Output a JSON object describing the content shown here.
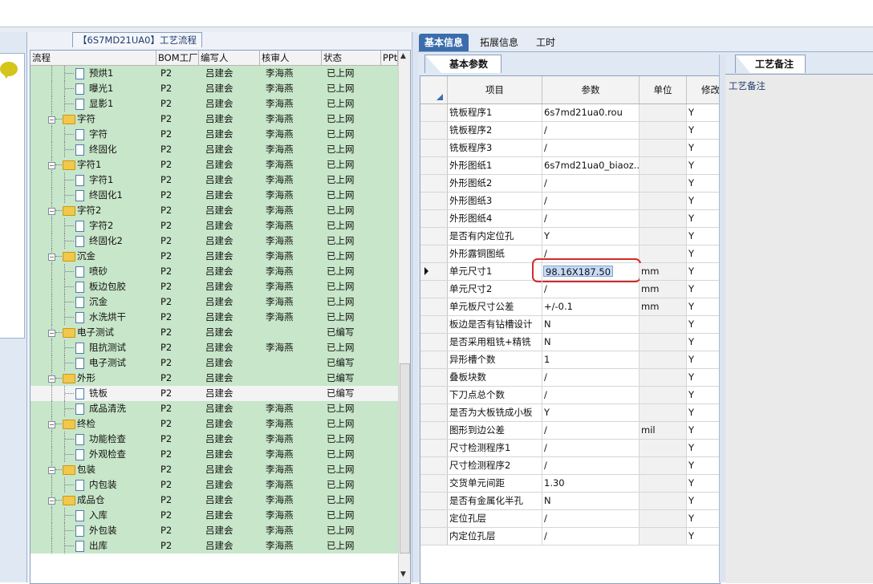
{
  "process_panel": {
    "title": "【6S7MD21UA0】工艺流程",
    "columns": [
      "流程",
      "BOM工厂",
      "编写人",
      "核审人",
      "状态",
      "PPt"
    ],
    "rows": [
      {
        "name": "预烘1",
        "level": 2,
        "type": "doc",
        "bom": "P2",
        "author": "吕建会",
        "reviewer": "李海燕",
        "status": "已上网"
      },
      {
        "name": "曝光1",
        "level": 2,
        "type": "doc",
        "bom": "P2",
        "author": "吕建会",
        "reviewer": "李海燕",
        "status": "已上网"
      },
      {
        "name": "显影1",
        "level": 2,
        "type": "doc",
        "bom": "P2",
        "author": "吕建会",
        "reviewer": "李海燕",
        "status": "已上网"
      },
      {
        "name": "字符",
        "level": 1,
        "type": "folder",
        "bom": "P2",
        "author": "吕建会",
        "reviewer": "李海燕",
        "status": "已上网"
      },
      {
        "name": "字符",
        "level": 2,
        "type": "doc",
        "bom": "P2",
        "author": "吕建会",
        "reviewer": "李海燕",
        "status": "已上网"
      },
      {
        "name": "终固化",
        "level": 2,
        "type": "doc",
        "bom": "P2",
        "author": "吕建会",
        "reviewer": "李海燕",
        "status": "已上网"
      },
      {
        "name": "字符1",
        "level": 1,
        "type": "folder",
        "bom": "P2",
        "author": "吕建会",
        "reviewer": "李海燕",
        "status": "已上网"
      },
      {
        "name": "字符1",
        "level": 2,
        "type": "doc",
        "bom": "P2",
        "author": "吕建会",
        "reviewer": "李海燕",
        "status": "已上网"
      },
      {
        "name": "终固化1",
        "level": 2,
        "type": "doc",
        "bom": "P2",
        "author": "吕建会",
        "reviewer": "李海燕",
        "status": "已上网"
      },
      {
        "name": "字符2",
        "level": 1,
        "type": "folder",
        "bom": "P2",
        "author": "吕建会",
        "reviewer": "李海燕",
        "status": "已上网"
      },
      {
        "name": "字符2",
        "level": 2,
        "type": "doc",
        "bom": "P2",
        "author": "吕建会",
        "reviewer": "李海燕",
        "status": "已上网"
      },
      {
        "name": "终固化2",
        "level": 2,
        "type": "doc",
        "bom": "P2",
        "author": "吕建会",
        "reviewer": "李海燕",
        "status": "已上网"
      },
      {
        "name": "沉金",
        "level": 1,
        "type": "folder",
        "bom": "P2",
        "author": "吕建会",
        "reviewer": "李海燕",
        "status": "已上网"
      },
      {
        "name": "喷砂",
        "level": 2,
        "type": "doc",
        "bom": "P2",
        "author": "吕建会",
        "reviewer": "李海燕",
        "status": "已上网"
      },
      {
        "name": "板边包胶",
        "level": 2,
        "type": "doc",
        "bom": "P2",
        "author": "吕建会",
        "reviewer": "李海燕",
        "status": "已上网"
      },
      {
        "name": "沉金",
        "level": 2,
        "type": "doc",
        "bom": "P2",
        "author": "吕建会",
        "reviewer": "李海燕",
        "status": "已上网"
      },
      {
        "name": "水洗烘干",
        "level": 2,
        "type": "doc",
        "bom": "P2",
        "author": "吕建会",
        "reviewer": "李海燕",
        "status": "已上网"
      },
      {
        "name": "电子测试",
        "level": 1,
        "type": "folder",
        "bom": "P2",
        "author": "吕建会",
        "reviewer": "",
        "status": "已编写"
      },
      {
        "name": "阻抗测试",
        "level": 2,
        "type": "doc",
        "bom": "P2",
        "author": "吕建会",
        "reviewer": "李海燕",
        "status": "已上网"
      },
      {
        "name": "电子测试",
        "level": 2,
        "type": "doc",
        "bom": "P2",
        "author": "吕建会",
        "reviewer": "",
        "status": "已编写"
      },
      {
        "name": "外形",
        "level": 1,
        "type": "folder",
        "bom": "P2",
        "author": "吕建会",
        "reviewer": "",
        "status": "已编写"
      },
      {
        "name": "铣板",
        "level": 2,
        "type": "doc",
        "bom": "P2",
        "author": "吕建会",
        "reviewer": "",
        "status": "已编写",
        "selected": true
      },
      {
        "name": "成品清洗",
        "level": 2,
        "type": "doc",
        "bom": "P2",
        "author": "吕建会",
        "reviewer": "李海燕",
        "status": "已上网"
      },
      {
        "name": "终检",
        "level": 1,
        "type": "folder",
        "bom": "P2",
        "author": "吕建会",
        "reviewer": "李海燕",
        "status": "已上网"
      },
      {
        "name": "功能检查",
        "level": 2,
        "type": "doc",
        "bom": "P2",
        "author": "吕建会",
        "reviewer": "李海燕",
        "status": "已上网"
      },
      {
        "name": "外观检查",
        "level": 2,
        "type": "doc",
        "bom": "P2",
        "author": "吕建会",
        "reviewer": "李海燕",
        "status": "已上网"
      },
      {
        "name": "包装",
        "level": 1,
        "type": "folder",
        "bom": "P2",
        "author": "吕建会",
        "reviewer": "李海燕",
        "status": "已上网"
      },
      {
        "name": "内包装",
        "level": 2,
        "type": "doc",
        "bom": "P2",
        "author": "吕建会",
        "reviewer": "李海燕",
        "status": "已上网"
      },
      {
        "name": "成品仓",
        "level": 1,
        "type": "folder",
        "bom": "P2",
        "author": "吕建会",
        "reviewer": "李海燕",
        "status": "已上网"
      },
      {
        "name": "入库",
        "level": 2,
        "type": "doc",
        "bom": "P2",
        "author": "吕建会",
        "reviewer": "李海燕",
        "status": "已上网"
      },
      {
        "name": "外包装",
        "level": 2,
        "type": "doc",
        "bom": "P2",
        "author": "吕建会",
        "reviewer": "李海燕",
        "status": "已上网"
      },
      {
        "name": "出库",
        "level": 2,
        "type": "doc",
        "bom": "P2",
        "author": "吕建会",
        "reviewer": "李海燕",
        "status": "已上网"
      }
    ]
  },
  "tabs": [
    "基本信息",
    "拓展信息",
    "工时"
  ],
  "active_tab": "基本信息",
  "subtab": "基本参数",
  "params_grid": {
    "columns": [
      "项目",
      "参数",
      "单位",
      "修改"
    ],
    "rows": [
      {
        "item": "铣板程序1",
        "value": "6s7md21ua0.rou",
        "unit": "",
        "mod": "Y"
      },
      {
        "item": "铣板程序2",
        "value": "/",
        "unit": "",
        "mod": "Y"
      },
      {
        "item": "铣板程序3",
        "value": "/",
        "unit": "",
        "mod": "Y"
      },
      {
        "item": "外形图纸1",
        "value": "6s7md21ua0_biaoz...",
        "unit": "",
        "mod": "Y"
      },
      {
        "item": "外形图纸2",
        "value": "/",
        "unit": "",
        "mod": "Y"
      },
      {
        "item": "外形图纸3",
        "value": "/",
        "unit": "",
        "mod": "Y"
      },
      {
        "item": "外形图纸4",
        "value": "/",
        "unit": "",
        "mod": "Y"
      },
      {
        "item": "是否有内定位孔",
        "value": "Y",
        "unit": "",
        "mod": "Y"
      },
      {
        "item": "外形露铜图纸",
        "value": "/",
        "unit": "",
        "mod": "Y"
      },
      {
        "item": "单元尺寸1",
        "value": "98.16X187.50",
        "unit": "mm",
        "mod": "Y",
        "editing": true
      },
      {
        "item": "单元尺寸2",
        "value": "/",
        "unit": "mm",
        "mod": "Y"
      },
      {
        "item": "单元板尺寸公差",
        "value": "+/-0.1",
        "unit": "mm",
        "mod": "Y"
      },
      {
        "item": "板边是否有钻槽设计",
        "value": "N",
        "unit": "",
        "mod": "Y"
      },
      {
        "item": "是否采用粗铣+精铣",
        "value": "N",
        "unit": "",
        "mod": "Y"
      },
      {
        "item": "异形槽个数",
        "value": "1",
        "unit": "",
        "mod": "Y"
      },
      {
        "item": "叠板块数",
        "value": "/",
        "unit": "",
        "mod": "Y"
      },
      {
        "item": "下刀点总个数",
        "value": "/",
        "unit": "",
        "mod": "Y"
      },
      {
        "item": "是否为大板铣成小板",
        "value": "Y",
        "unit": "",
        "mod": "Y"
      },
      {
        "item": "图形到边公差",
        "value": "/",
        "unit": "mil",
        "mod": "Y"
      },
      {
        "item": "尺寸检测程序1",
        "value": "/",
        "unit": "",
        "mod": "Y"
      },
      {
        "item": "尺寸检测程序2",
        "value": "/",
        "unit": "",
        "mod": "Y"
      },
      {
        "item": "交货单元间距",
        "value": "1.30",
        "unit": "",
        "mod": "Y"
      },
      {
        "item": "是否有金属化半孔",
        "value": "N",
        "unit": "",
        "mod": "Y"
      },
      {
        "item": "定位孔层",
        "value": "/",
        "unit": "",
        "mod": "Y"
      },
      {
        "item": "内定位孔层",
        "value": "/",
        "unit": "",
        "mod": "Y"
      }
    ]
  },
  "remarks": {
    "tab": "工艺备注",
    "label": "工艺备注"
  },
  "colors": {
    "row_green": "#c8e6c9",
    "tab_active": "#3b6dad",
    "highlight": "#d42b2b"
  }
}
